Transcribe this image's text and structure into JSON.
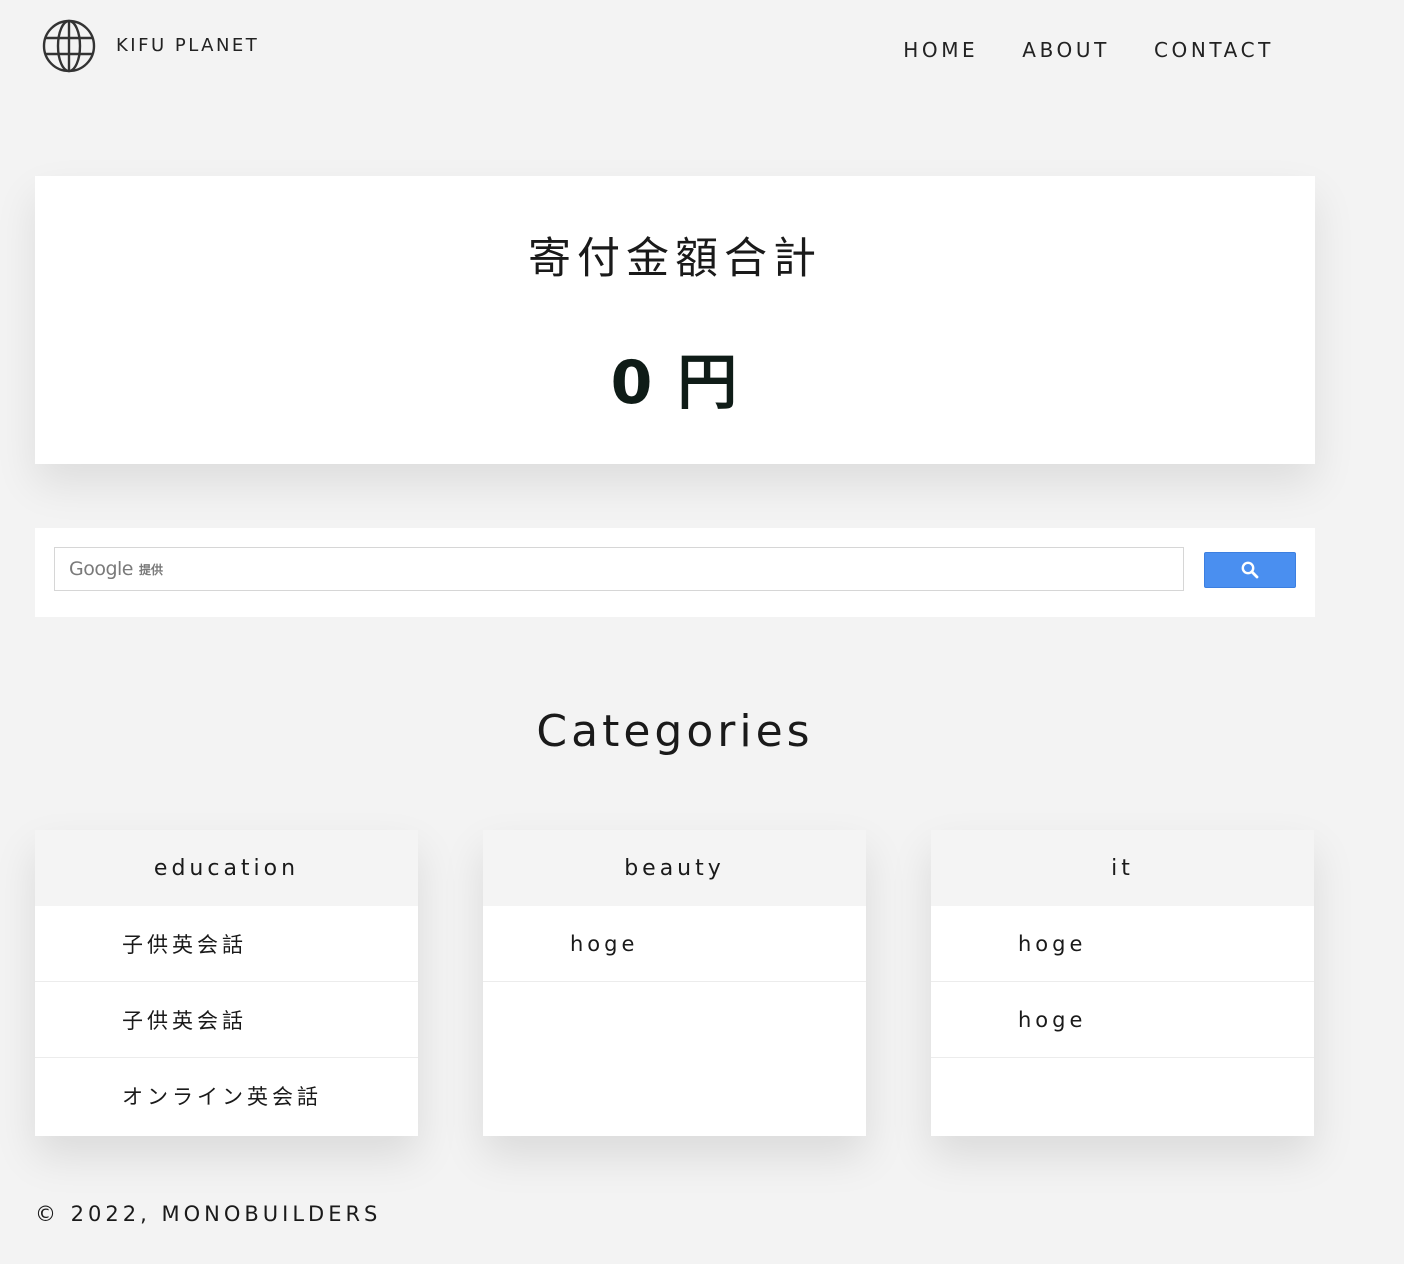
{
  "header": {
    "logo_text": "KIFU PLANET",
    "nav": [
      {
        "label": "HOME"
      },
      {
        "label": "ABOUT"
      },
      {
        "label": "CONTACT"
      }
    ]
  },
  "total": {
    "title": "寄付金額合計",
    "amount": "0 円"
  },
  "search": {
    "brand": "Google",
    "brand_suffix": "提供",
    "button_icon": "search-icon"
  },
  "categories": {
    "title": "Categories",
    "cards": [
      {
        "name": "education",
        "items": [
          "子供英会話",
          "子供英会話",
          "オンライン英会話"
        ]
      },
      {
        "name": "beauty",
        "items": [
          "hoge"
        ]
      },
      {
        "name": "it",
        "items": [
          "hoge",
          "hoge"
        ]
      }
    ]
  },
  "footer": {
    "text": "© 2022, MONOBUILDERS"
  },
  "colors": {
    "background": "#f3f3f3",
    "search_button": "#4a8ff0",
    "amount_text": "#0f1c17"
  }
}
